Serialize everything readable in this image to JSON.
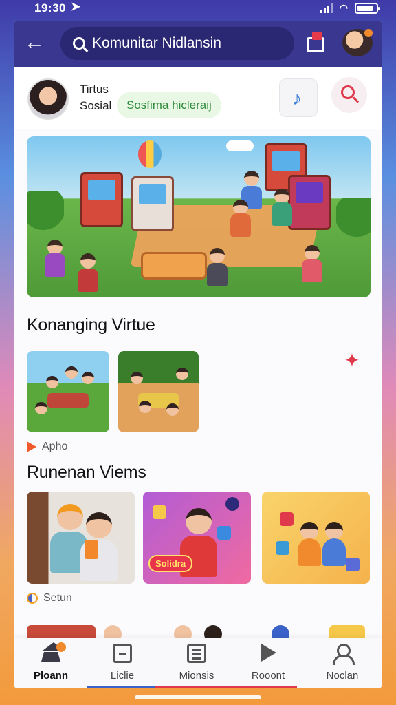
{
  "status_bar": {
    "time": "19:30",
    "battery_level": 0.85
  },
  "topbar": {
    "search_text": "Komunitar Nidlansin"
  },
  "profile": {
    "name": "Tirtus",
    "subtitle": "Sosial",
    "tag": "Sosfima hicleraij"
  },
  "sections": {
    "first_title": "Konanging Virtue",
    "first_meta": "Apho",
    "second_title": "Runenan Viems",
    "second_meta": "Setun"
  },
  "view_cards": {
    "badge": "Solidra"
  },
  "bottom_nav": {
    "items": [
      {
        "label": "Ploann",
        "icon": "home-icon"
      },
      {
        "label": "Liclie",
        "icon": "image-icon"
      },
      {
        "label": "Mionsis",
        "icon": "list-icon"
      },
      {
        "label": "Rooont",
        "icon": "play-icon"
      },
      {
        "label": "Noclan",
        "icon": "user-icon"
      }
    ]
  },
  "colors": {
    "topbar": "#3a3790",
    "accent_red": "#e0394b",
    "accent_orange": "#f08a2c",
    "tag_green": "#2e8a3a"
  }
}
